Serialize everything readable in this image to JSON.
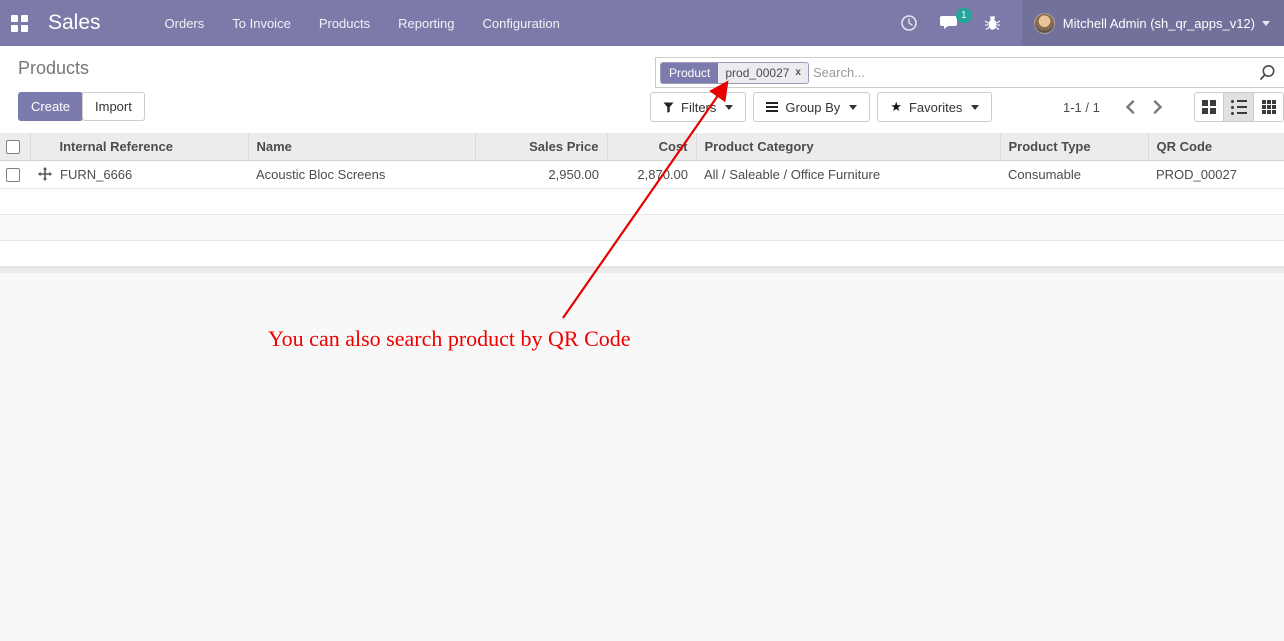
{
  "navbar": {
    "app_name": "Sales",
    "menu_items": [
      "Orders",
      "To Invoice",
      "Products",
      "Reporting",
      "Configuration"
    ],
    "systray": {
      "message_count": "1",
      "user_name": "Mitchell Admin (sh_qr_apps_v12)"
    }
  },
  "control_panel": {
    "breadcrumb": "Products",
    "buttons": {
      "create": "Create",
      "import": "Import"
    },
    "search": {
      "facet_label": "Product",
      "facet_value": "prod_00027",
      "remove_facet": "x",
      "placeholder": "Search..."
    },
    "filter_buttons": {
      "filters": "Filters",
      "group_by": "Group By",
      "favorites": "Favorites"
    },
    "pager": {
      "range": "1-1 / 1"
    }
  },
  "table": {
    "columns": [
      "Internal Reference",
      "Name",
      "Sales Price",
      "Cost",
      "Product Category",
      "Product Type",
      "QR Code"
    ],
    "rows": [
      {
        "internal_reference": "FURN_6666",
        "name": "Acoustic Bloc Screens",
        "sales_price": "2,950.00",
        "cost": "2,870.00",
        "product_category": "All / Saleable / Office Furniture",
        "product_type": "Consumable",
        "qr_code": "PROD_00027"
      }
    ]
  },
  "annotation": {
    "text": "You can also search product by QR Code"
  },
  "icons": {
    "favorites_star": "★"
  },
  "colors": {
    "brand": "#7c7bad",
    "navbar": "#7b7aa8",
    "badge": "#23a69a",
    "annotation": "#ee0000"
  }
}
